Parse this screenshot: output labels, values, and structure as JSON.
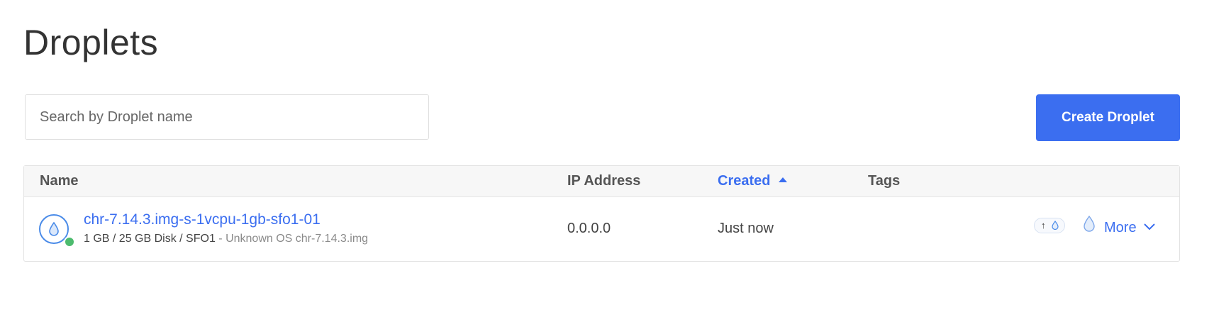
{
  "header": {
    "title": "Droplets"
  },
  "search": {
    "placeholder": "Search by Droplet name",
    "value": ""
  },
  "actions": {
    "create_label": "Create Droplet"
  },
  "table": {
    "columns": {
      "name": "Name",
      "ip": "IP Address",
      "created": "Created",
      "tags": "Tags"
    },
    "sort": {
      "column": "created",
      "direction": "ascending"
    },
    "rows": [
      {
        "name": "chr-7.14.3.img-s-1vcpu-1gb-sfo1-01",
        "specs": "1 GB / 25 GB Disk / SFO1",
        "os": "- Unknown OS chr-7.14.3.img",
        "ip": "0.0.0.0",
        "created": "Just now",
        "tags": "",
        "status": "active",
        "more_label": "More"
      }
    ]
  },
  "colors": {
    "accent": "#3b6ef0",
    "status_active": "#4dbb6e"
  },
  "icons": {
    "droplet": "droplet-icon",
    "resize": "resize-up-icon",
    "chevron": "chevron-down-icon"
  }
}
